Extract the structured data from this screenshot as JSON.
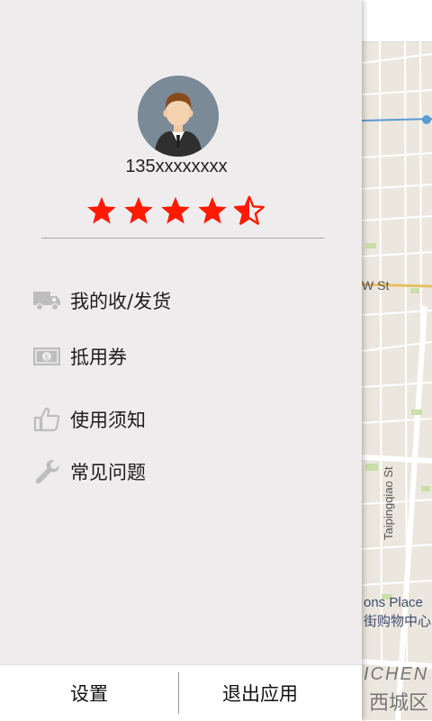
{
  "user": {
    "phone": "135xxxxxxxx",
    "rating": 4.5,
    "rating_max": 5,
    "star_color": "#ff1a00"
  },
  "menu": {
    "items": [
      {
        "label": "我的收/发货",
        "icon": "truck-icon"
      },
      {
        "label": "抵用券",
        "icon": "banknote-icon"
      },
      {
        "label": "使用须知",
        "icon": "thumbs-up-icon"
      },
      {
        "label": "常见问题",
        "icon": "wrench-icon"
      }
    ]
  },
  "bottom": {
    "settings_label": "设置",
    "logout_label": "退出应用"
  },
  "map": {
    "street_label": "W St",
    "road_label": "Taipingqiao St",
    "place_label_1": "ons Place",
    "place_label_2": "街购物中心",
    "area_label_1": "ICHEN",
    "area_label_2": "西城区"
  }
}
